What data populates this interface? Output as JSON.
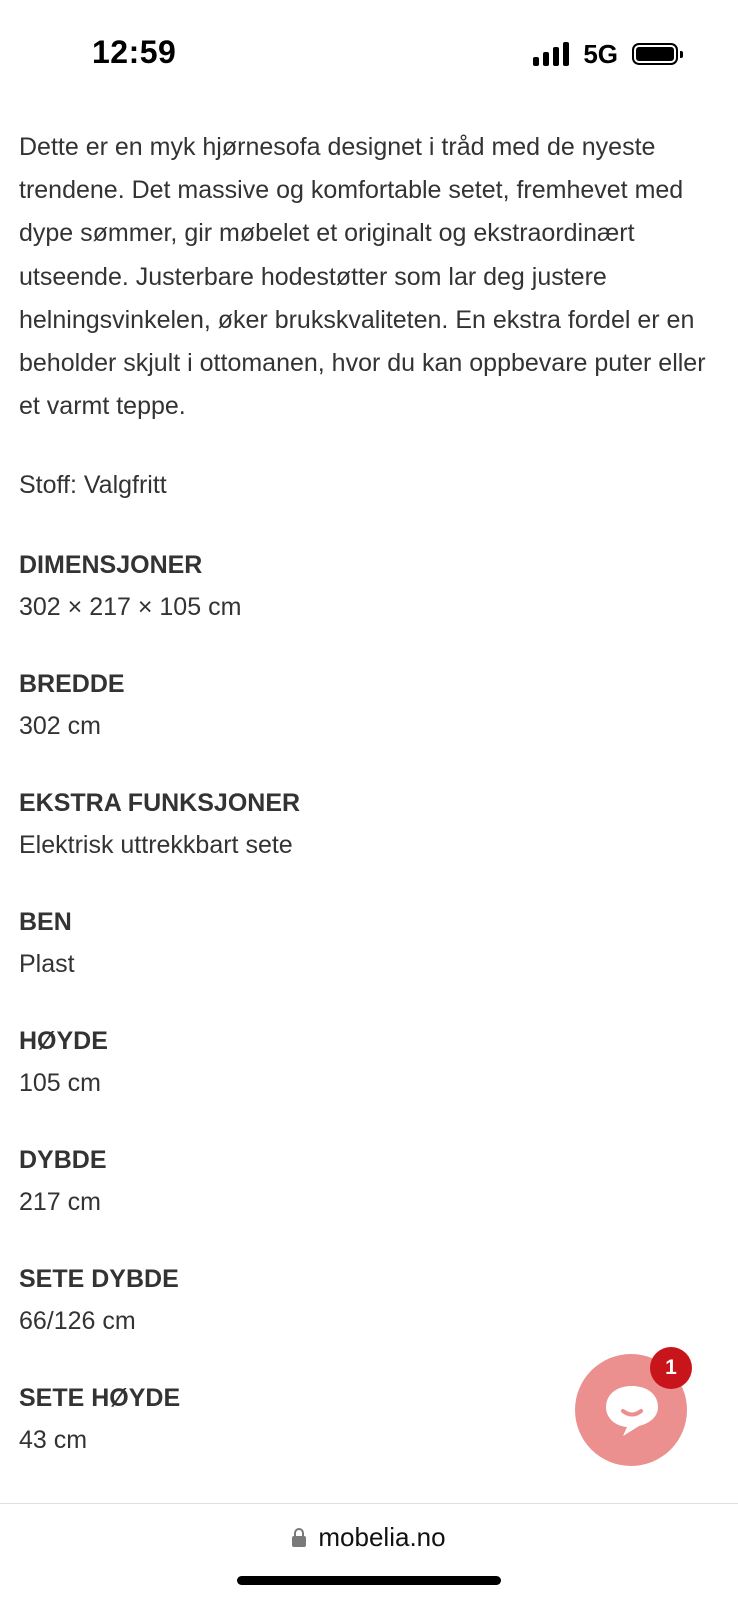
{
  "status_bar": {
    "time": "12:59",
    "network": "5G",
    "icons": [
      "signal-icon",
      "battery-icon"
    ]
  },
  "product": {
    "description": "Dette er en myk hjørnesofa designet i tråd med de nyeste trendene. Det massive og komfortable setet, fremhevet med dype sømmer, gir møbelet et originalt og ekstraordinært utseende. Justerbare hodestøtter som lar deg justere helningsvinkelen, øker brukskvaliteten. En ekstra fordel er en beholder skjult i ottomanen, hvor du kan oppbevare puter eller et varmt teppe.",
    "fabric": "Stoff: Valgfritt",
    "specs": [
      {
        "label": "DIMENSJONER",
        "value": "302 × 217 × 105 cm"
      },
      {
        "label": "BREDDE",
        "value": "302 cm"
      },
      {
        "label": "EKSTRA FUNKSJONER",
        "value": "Elektrisk uttrekkbart sete"
      },
      {
        "label": "BEN",
        "value": "Plast"
      },
      {
        "label": "HØYDE",
        "value": "105 cm"
      },
      {
        "label": "DYBDE",
        "value": "217 cm"
      },
      {
        "label": "SETE DYBDE",
        "value": "66/126 cm"
      },
      {
        "label": "SETE HØYDE",
        "value": "43 cm"
      }
    ]
  },
  "chat": {
    "badge_count": "1",
    "icon": "chat-bubble-icon",
    "button_color": "#eb8f8f",
    "badge_color": "#c8141b"
  },
  "browser": {
    "url": "mobelia.no",
    "icon": "lock-icon"
  }
}
